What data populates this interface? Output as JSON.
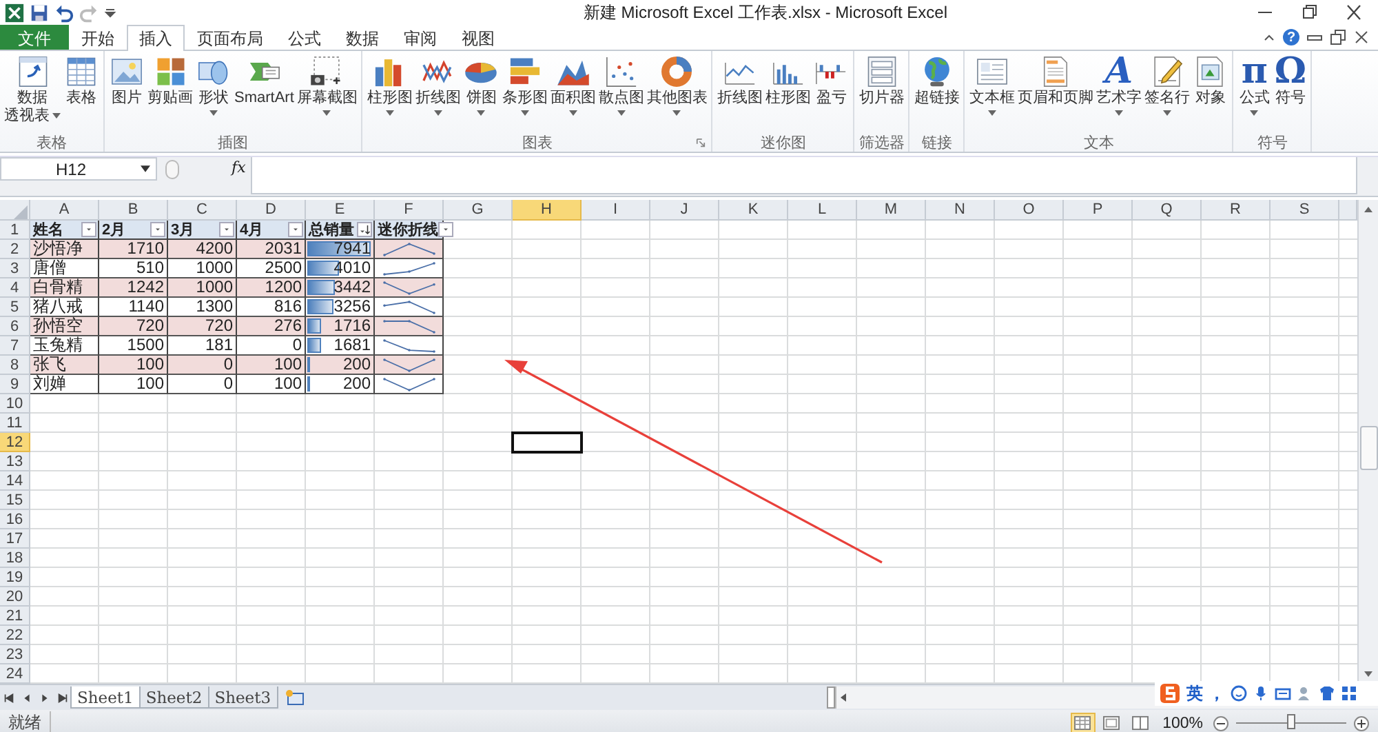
{
  "title_bar": {
    "title": "新建 Microsoft Excel 工作表.xlsx - Microsoft Excel"
  },
  "tabs": [
    {
      "label": "文件",
      "kind": "file",
      "selected": false
    },
    {
      "label": "开始",
      "kind": "tab",
      "selected": false
    },
    {
      "label": "插入",
      "kind": "tab",
      "selected": true
    },
    {
      "label": "页面布局",
      "kind": "tab",
      "selected": false
    },
    {
      "label": "公式",
      "kind": "tab",
      "selected": false
    },
    {
      "label": "数据",
      "kind": "tab",
      "selected": false
    },
    {
      "label": "审阅",
      "kind": "tab",
      "selected": false
    },
    {
      "label": "视图",
      "kind": "tab",
      "selected": false
    }
  ],
  "help_label": "?",
  "ribbon_groups": [
    {
      "label": "表格",
      "launcher": false,
      "items": [
        {
          "label": "数据",
          "label2": "透视表",
          "dropdown": true
        },
        {
          "label": "表格",
          "dropdown": false
        }
      ]
    },
    {
      "label": "插图",
      "launcher": false,
      "items": [
        {
          "label": "图片",
          "dropdown": false
        },
        {
          "label": "剪贴画",
          "dropdown": false
        },
        {
          "label": "形状",
          "dropdown": true
        },
        {
          "label": "SmartArt",
          "dropdown": false
        },
        {
          "label": "屏幕截图",
          "dropdown": true
        }
      ]
    },
    {
      "label": "图表",
      "launcher": true,
      "items": [
        {
          "label": "柱形图",
          "dropdown": true
        },
        {
          "label": "折线图",
          "dropdown": true
        },
        {
          "label": "饼图",
          "dropdown": true
        },
        {
          "label": "条形图",
          "dropdown": true
        },
        {
          "label": "面积图",
          "dropdown": true
        },
        {
          "label": "散点图",
          "dropdown": true
        },
        {
          "label": "其他图表",
          "dropdown": true
        }
      ]
    },
    {
      "label": "迷你图",
      "launcher": false,
      "items": [
        {
          "label": "折线图",
          "dropdown": false
        },
        {
          "label": "柱形图",
          "dropdown": false
        },
        {
          "label": "盈亏",
          "dropdown": false
        }
      ]
    },
    {
      "label": "筛选器",
      "launcher": false,
      "items": [
        {
          "label": "切片器",
          "dropdown": false
        }
      ]
    },
    {
      "label": "链接",
      "launcher": false,
      "items": [
        {
          "label": "超链接",
          "dropdown": false
        }
      ]
    },
    {
      "label": "文本",
      "launcher": false,
      "items": [
        {
          "label": "文本框",
          "dropdown": true
        },
        {
          "label": "页眉和页脚",
          "dropdown": false
        },
        {
          "label": "艺术字",
          "dropdown": true,
          "glyph": "A"
        },
        {
          "label": "签名行",
          "dropdown": true
        },
        {
          "label": "对象",
          "dropdown": false
        }
      ]
    },
    {
      "label": "符号",
      "launcher": false,
      "items": [
        {
          "label": "公式",
          "dropdown": true,
          "glyph": "π"
        },
        {
          "label": "符号",
          "dropdown": false,
          "glyph": "Ω"
        }
      ]
    }
  ],
  "formula_bar": {
    "name_box": "H12",
    "function_label": "fx"
  },
  "sheet": {
    "columns": [
      {
        "label": "A",
        "selected": false
      },
      {
        "label": "B",
        "selected": false
      },
      {
        "label": "C",
        "selected": false
      },
      {
        "label": "D",
        "selected": false
      },
      {
        "label": "E",
        "selected": false
      },
      {
        "label": "F",
        "selected": false
      },
      {
        "label": "G",
        "selected": false
      },
      {
        "label": "H",
        "selected": true
      },
      {
        "label": "I",
        "selected": false
      },
      {
        "label": "J",
        "selected": false
      },
      {
        "label": "K",
        "selected": false
      },
      {
        "label": "L",
        "selected": false
      },
      {
        "label": "M",
        "selected": false
      },
      {
        "label": "N",
        "selected": false
      },
      {
        "label": "O",
        "selected": false
      },
      {
        "label": "P",
        "selected": false
      },
      {
        "label": "Q",
        "selected": false
      },
      {
        "label": "R",
        "selected": false
      },
      {
        "label": "S",
        "selected": false
      }
    ],
    "rows": [
      {
        "label": "1",
        "selected": false
      },
      {
        "label": "2",
        "selected": false
      },
      {
        "label": "3",
        "selected": false
      },
      {
        "label": "4",
        "selected": false
      },
      {
        "label": "5",
        "selected": false
      },
      {
        "label": "6",
        "selected": false
      },
      {
        "label": "7",
        "selected": false
      },
      {
        "label": "8",
        "selected": false
      },
      {
        "label": "9",
        "selected": false
      },
      {
        "label": "10",
        "selected": false
      },
      {
        "label": "11",
        "selected": false
      },
      {
        "label": "12",
        "selected": true
      },
      {
        "label": "13",
        "selected": false
      },
      {
        "label": "14",
        "selected": false
      },
      {
        "label": "15",
        "selected": false
      },
      {
        "label": "16",
        "selected": false
      },
      {
        "label": "17",
        "selected": false
      },
      {
        "label": "18",
        "selected": false
      },
      {
        "label": "19",
        "selected": false
      },
      {
        "label": "20",
        "selected": false
      },
      {
        "label": "21",
        "selected": false
      },
      {
        "label": "22",
        "selected": false
      },
      {
        "label": "23",
        "selected": false
      },
      {
        "label": "24",
        "selected": false
      }
    ],
    "table": {
      "header": [
        {
          "text": "姓名",
          "sorted": false
        },
        {
          "text": "2月",
          "sorted": false
        },
        {
          "text": "3月",
          "sorted": false
        },
        {
          "text": "4月",
          "sorted": false
        },
        {
          "text": "总销量",
          "sorted": true
        },
        {
          "text": "迷你折线",
          "sorted": false
        }
      ],
      "rows": [
        {
          "shaded": true,
          "cells": [
            "沙悟净",
            "1710",
            "4200",
            "2031",
            "7941"
          ],
          "bar": {
            "level": 1
          }
        },
        {
          "shaded": false,
          "cells": [
            "唐僧",
            "510",
            "1000",
            "2500",
            "4010"
          ],
          "bar": {
            "level": 0.505
          }
        },
        {
          "shaded": true,
          "cells": [
            "白骨精",
            "1242",
            "1000",
            "1200",
            "3442"
          ],
          "bar": {
            "level": 0.433
          }
        },
        {
          "shaded": false,
          "cells": [
            "猪八戒",
            "1140",
            "1300",
            "816",
            "3256"
          ],
          "bar": {
            "level": 0.41
          }
        },
        {
          "shaded": true,
          "cells": [
            "孙悟空",
            "720",
            "720",
            "276",
            "1716"
          ],
          "bar": {
            "level": 0.216
          }
        },
        {
          "shaded": false,
          "cells": [
            "玉兔精",
            "1500",
            "181",
            "0",
            "1681"
          ],
          "bar": {
            "level": 0.212
          }
        },
        {
          "shaded": true,
          "cells": [
            "张飞",
            "100",
            "0",
            "100",
            "200"
          ],
          "bar": {
            "level": 0.025
          }
        },
        {
          "shaded": false,
          "cells": [
            "刘婵",
            "100",
            "0",
            "100",
            "200"
          ],
          "bar": {
            "level": 0.025
          }
        }
      ]
    }
  },
  "sheet_tabs": [
    {
      "label": "Sheet1",
      "selected": true
    },
    {
      "label": "Sheet2",
      "selected": false
    },
    {
      "label": "Sheet3",
      "selected": false
    }
  ],
  "ime_toolbar": {
    "mode": "英",
    "punctuation": "，"
  },
  "status_bar": {
    "status": "就绪",
    "view_buttons": [
      {
        "selected": true
      },
      {
        "selected": false
      },
      {
        "selected": false
      }
    ],
    "zoom": "100%",
    "zoom_slider": {
      "level": 0.5
    }
  }
}
